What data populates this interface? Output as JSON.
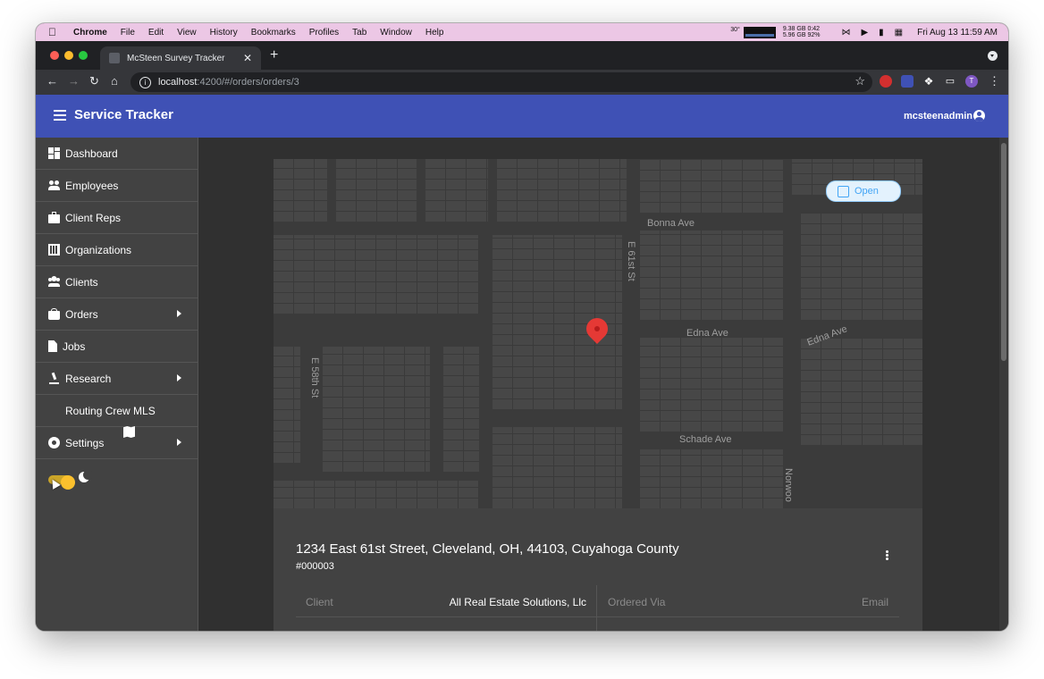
{
  "menubar": {
    "app": "Chrome",
    "items": [
      "File",
      "Edit",
      "View",
      "History",
      "Bookmarks",
      "Profiles",
      "Tab",
      "Window",
      "Help"
    ],
    "temp": "30°",
    "mem1": "9.38 GB 0:42",
    "mem2": "5.96 GB 92%",
    "clock": "Fri Aug 13  11:59 AM"
  },
  "browser": {
    "tab_title": "McSteen Survey Tracker",
    "url_host": "localhost",
    "url_rest": ":4200/#/orders/orders/3",
    "profile_initial": "T"
  },
  "header": {
    "title": "Service Tracker",
    "user": "mcsteenadmin"
  },
  "sidebar": {
    "items": [
      {
        "label": "Dashboard"
      },
      {
        "label": "Employees"
      },
      {
        "label": "Client Reps"
      },
      {
        "label": "Organizations"
      },
      {
        "label": "Clients"
      },
      {
        "label": "Orders"
      },
      {
        "label": "Jobs"
      },
      {
        "label": "Research"
      },
      {
        "label": "Routing Crew MLS"
      },
      {
        "label": "Settings"
      }
    ]
  },
  "map": {
    "open_label": "Open",
    "streets": {
      "bonna": "Bonna Ave",
      "e61": "E 61st St",
      "edna1": "Edna Ave",
      "edna2": "Edna Ave",
      "e58": "E 58th St",
      "schade": "Schade Ave",
      "norwood": "Norwoo"
    }
  },
  "order": {
    "address": "1234 East 61st Street, Cleveland, OH, 44103, Cuyahoga County",
    "number": "#000003",
    "client_label": "Client",
    "client_value": "All Real Estate Solutions, Llc",
    "ordered_via_label": "Ordered Via",
    "ordered_via_value": "Email"
  },
  "colors": {
    "primary": "#3f51b5",
    "sidebar": "#424242",
    "background": "#303030",
    "toggle": "#fbc02d",
    "pin": "#e53935",
    "chip": "#42a5f5"
  }
}
